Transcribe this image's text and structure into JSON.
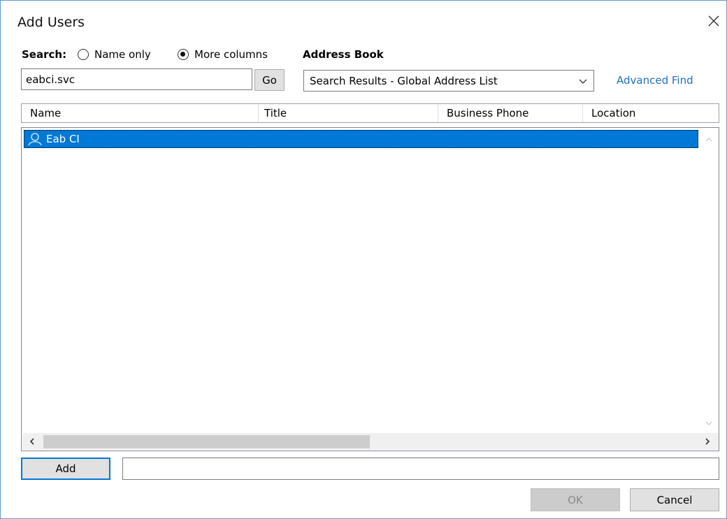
{
  "window": {
    "title": "Add Users",
    "close_icon": "close-icon"
  },
  "search": {
    "label": "Search:",
    "options": [
      {
        "label": "Name only",
        "selected": false
      },
      {
        "label": "More columns",
        "selected": true
      }
    ],
    "value": "eabci.svc",
    "go_label": "Go"
  },
  "address_book": {
    "label": "Address Book",
    "selected": "Search Results - Global Address List",
    "advanced_find_label": "Advanced Find"
  },
  "results": {
    "columns": [
      "Name",
      "Title",
      "Business Phone",
      "Location"
    ],
    "rows": [
      {
        "name": "Eab CI",
        "title": "",
        "business_phone": "",
        "location": "",
        "selected": true,
        "icon": "user-icon"
      }
    ]
  },
  "footer": {
    "add_label": "Add",
    "add_value": "",
    "ok_label": "OK",
    "ok_enabled": false,
    "cancel_label": "Cancel"
  },
  "colors": {
    "accent": "#0078d7",
    "link": "#1f6fbf",
    "border": "#5b9bd5"
  }
}
